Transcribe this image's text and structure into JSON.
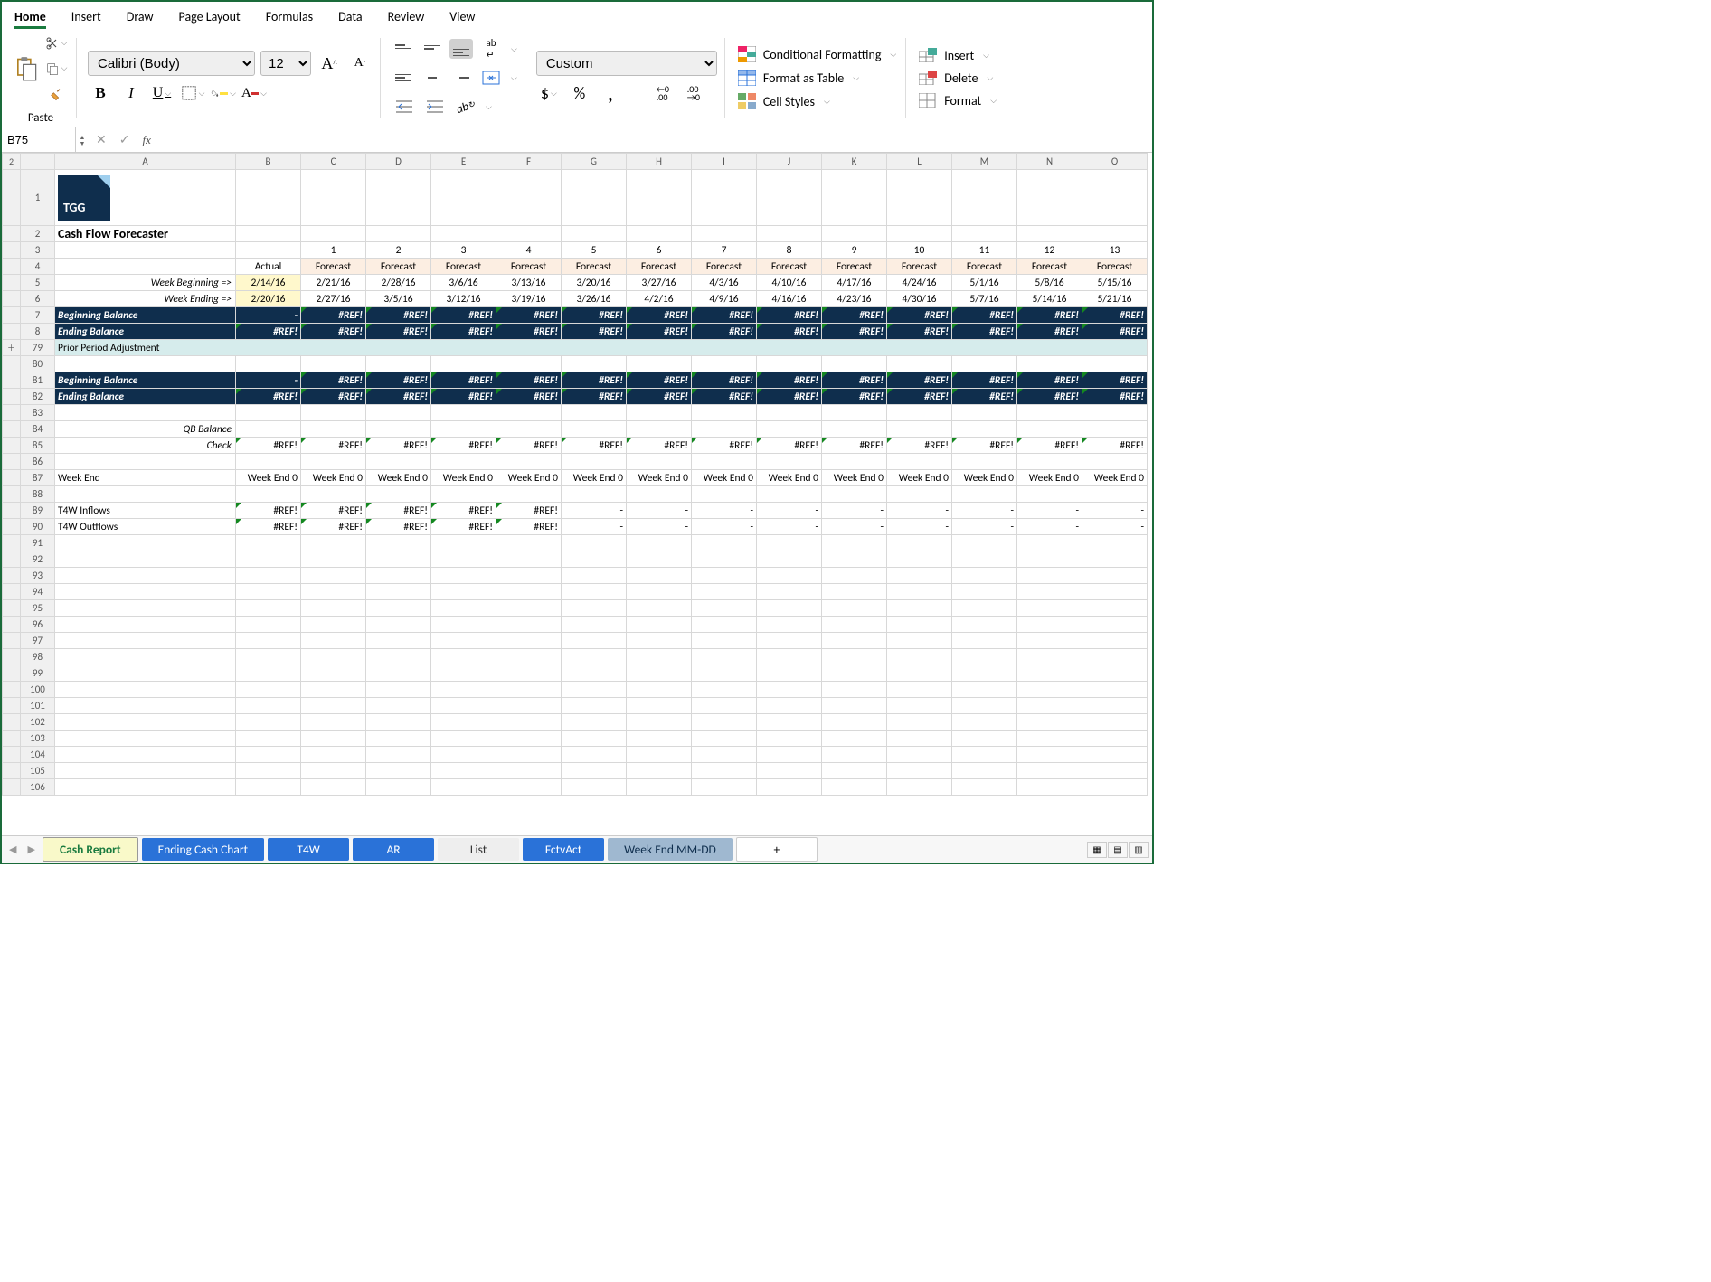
{
  "menu": {
    "home": "Home",
    "insert": "Insert",
    "draw": "Draw",
    "pagelayout": "Page Layout",
    "formulas": "Formulas",
    "data": "Data",
    "review": "Review",
    "view": "View"
  },
  "ribbon": {
    "paste": "Paste",
    "font": "Calibri (Body)",
    "size": "12",
    "numformat": "Custom",
    "cond": "Conditional Formatting",
    "fmttable": "Format as Table",
    "cellstyles": "Cell Styles",
    "insert": "Insert",
    "delete": "Delete",
    "format": "Format"
  },
  "name": "B75",
  "formula": "",
  "logo": "TGG",
  "title": "Cash Flow Forecaster",
  "r3": [
    "",
    "1",
    "2",
    "3",
    "4",
    "5",
    "6",
    "7",
    "8",
    "9",
    "10",
    "11",
    "12",
    "13"
  ],
  "r4": [
    "Actual",
    "Forecast",
    "Forecast",
    "Forecast",
    "Forecast",
    "Forecast",
    "Forecast",
    "Forecast",
    "Forecast",
    "Forecast",
    "Forecast",
    "Forecast",
    "Forecast",
    "Forecast"
  ],
  "r5lab": "Week Beginning =>",
  "r5": [
    "2/14/16",
    "2/21/16",
    "2/28/16",
    "3/6/16",
    "3/13/16",
    "3/20/16",
    "3/27/16",
    "4/3/16",
    "4/10/16",
    "4/17/16",
    "4/24/16",
    "5/1/16",
    "5/8/16",
    "5/15/16"
  ],
  "r6lab": "Week Ending =>",
  "r6": [
    "2/20/16",
    "2/27/16",
    "3/5/16",
    "3/12/16",
    "3/19/16",
    "3/26/16",
    "4/2/16",
    "4/9/16",
    "4/16/16",
    "4/23/16",
    "4/30/16",
    "5/7/16",
    "5/14/16",
    "5/21/16"
  ],
  "r7lab": "Beginning Balance",
  "r7": [
    "-",
    "#REF!",
    "#REF!",
    "#REF!",
    "#REF!",
    "#REF!",
    "#REF!",
    "#REF!",
    "#REF!",
    "#REF!",
    "#REF!",
    "#REF!",
    "#REF!",
    "#REF!"
  ],
  "r8lab": "Ending Balance",
  "r8": [
    "#REF!",
    "#REF!",
    "#REF!",
    "#REF!",
    "#REF!",
    "#REF!",
    "#REF!",
    "#REF!",
    "#REF!",
    "#REF!",
    "#REF!",
    "#REF!",
    "#REF!",
    "#REF!"
  ],
  "r79": "Prior Period Adjustment",
  "r81lab": "Beginning Balance",
  "r81": [
    "-",
    "#REF!",
    "#REF!",
    "#REF!",
    "#REF!",
    "#REF!",
    "#REF!",
    "#REF!",
    "#REF!",
    "#REF!",
    "#REF!",
    "#REF!",
    "#REF!",
    "#REF!"
  ],
  "r82lab": "Ending Balance",
  "r82": [
    "#REF!",
    "#REF!",
    "#REF!",
    "#REF!",
    "#REF!",
    "#REF!",
    "#REF!",
    "#REF!",
    "#REF!",
    "#REF!",
    "#REF!",
    "#REF!",
    "#REF!",
    "#REF!"
  ],
  "r84": "QB Balance",
  "r85lab": "Check",
  "r85": [
    "#REF!",
    "#REF!",
    "#REF!",
    "#REF!",
    "#REF!",
    "#REF!",
    "#REF!",
    "#REF!",
    "#REF!",
    "#REF!",
    "#REF!",
    "#REF!",
    "#REF!",
    "#REF!"
  ],
  "r87lab": "Week End",
  "r87": [
    "Week End 0",
    "Week End 0",
    "Week End 0",
    "Week End 0",
    "Week End 0",
    "Week End 0",
    "Week End 0",
    "Week End 0",
    "Week End 0",
    "Week End 0",
    "Week End 0",
    "Week End 0",
    "Week End 0",
    "Week End 0"
  ],
  "r89lab": "T4W Inflows",
  "r89": [
    "#REF!",
    "#REF!",
    "#REF!",
    "#REF!",
    "#REF!",
    "-",
    "-",
    "-",
    "-",
    "-",
    "-",
    "-",
    "-",
    "-"
  ],
  "r90lab": "T4W Outflows",
  "r90": [
    "#REF!",
    "#REF!",
    "#REF!",
    "#REF!",
    "#REF!",
    "-",
    "-",
    "-",
    "-",
    "-",
    "-",
    "-",
    "-",
    "-"
  ],
  "sheets": {
    "cash": "Cash Report",
    "ending": "Ending Cash Chart",
    "t4w": "T4W",
    "ar": "AR",
    "list": "List",
    "fct": "FctvAct",
    "week": "Week End MM-DD",
    "add": "+"
  },
  "cols": [
    "A",
    "B",
    "C",
    "D",
    "E",
    "F",
    "G",
    "H",
    "I",
    "J",
    "K",
    "L",
    "M",
    "N",
    "O"
  ],
  "rows": [
    "1",
    "2",
    "3",
    "4",
    "5",
    "6",
    "7",
    "8",
    "79",
    "80",
    "81",
    "82",
    "83",
    "84",
    "85",
    "86",
    "87",
    "88",
    "89",
    "90",
    "91",
    "92",
    "93",
    "94",
    "95",
    "96",
    "97",
    "98",
    "99",
    "100",
    "101",
    "102",
    "103",
    "104",
    "105",
    "106"
  ]
}
